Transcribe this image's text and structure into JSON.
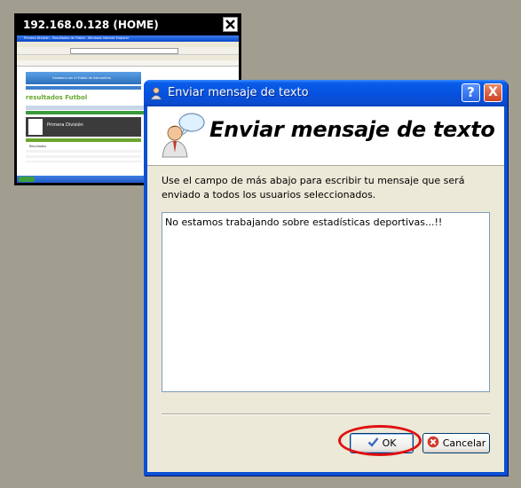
{
  "remote_window": {
    "title": "192.168.0.128 (HOME)",
    "close_icon": "close-icon"
  },
  "remote_screen": {
    "browser_title": "Primera División - Resultados de Fútbol - Windows Internet Explorer",
    "site_banner": "Golabora con el Fútbol de Salmantino",
    "site_logo": "resultados Futbol",
    "section_title": "Primera División",
    "tab_results": "Resultados",
    "tab_start": "Inicio"
  },
  "dialog": {
    "title": "Enviar mensaje de texto",
    "header_title": "Enviar mensaje de texto",
    "description": "Use el campo de más abajo para escribir tu mensaje que será enviado a todos los usuarios seleccionados.",
    "message_value": "No estamos trabajando sobre estadísticas deportivas...!!",
    "ok_label": "OK",
    "cancel_label": "Cancelar",
    "help_label": "?",
    "close_label": "X"
  },
  "colors": {
    "titlebar": "#0553e0",
    "highlight": "#e01010",
    "desktop": "#a19e8f"
  }
}
